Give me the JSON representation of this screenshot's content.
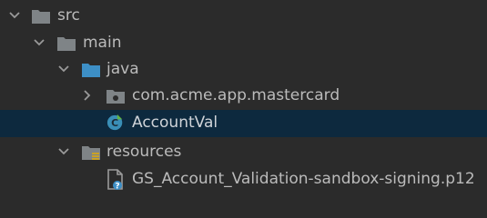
{
  "tree": {
    "rows": [
      {
        "label": "src",
        "state": "expanded",
        "icon": "folder-icon"
      },
      {
        "label": "main",
        "state": "expanded",
        "icon": "folder-icon"
      },
      {
        "label": "java",
        "state": "expanded",
        "icon": "source-root-folder-icon"
      },
      {
        "label": "com.acme.app.mastercard",
        "state": "collapsed",
        "icon": "package-icon"
      },
      {
        "label": "AccountVal",
        "state": "leaf",
        "selected": true,
        "icon": "java-class-icon"
      },
      {
        "label": "resources",
        "state": "expanded",
        "icon": "resources-folder-icon"
      },
      {
        "label": "GS_Account_Validation-sandbox-signing.p12",
        "state": "leaf",
        "icon": "unknown-file-icon"
      }
    ]
  },
  "colors": {
    "background": "#2b2b2b",
    "selection": "#0d293e",
    "text": "#bbbbbb",
    "folder": "#7f8487",
    "source_folder": "#3d8fc6",
    "class_badge": "#3a8fb7",
    "resources_stripe": "#c9a227"
  }
}
